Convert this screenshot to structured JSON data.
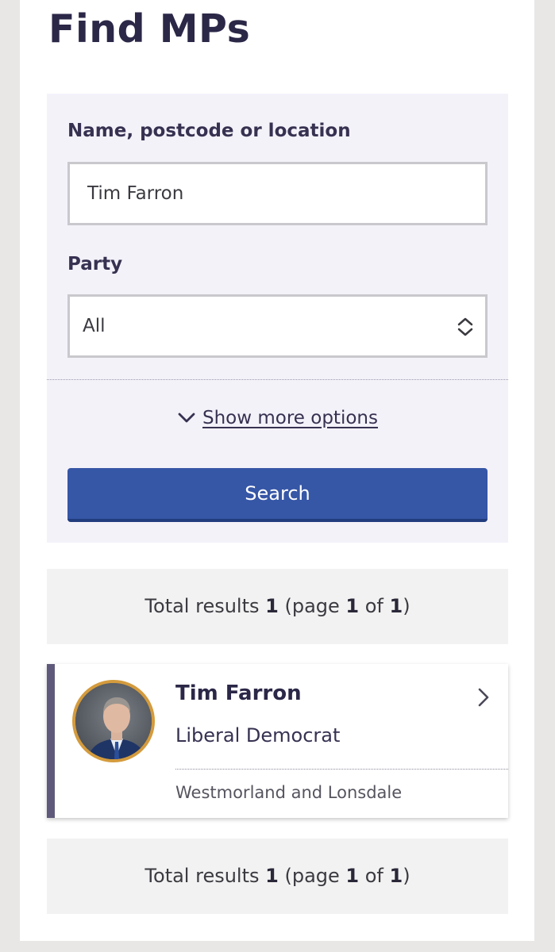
{
  "page": {
    "title": "Find MPs"
  },
  "search": {
    "name_label": "Name, postcode or location",
    "name_value": "Tim Farron",
    "party_label": "Party",
    "party_value": "All",
    "more_options_label": "Show more options",
    "search_button_label": "Search"
  },
  "results_summary": {
    "prefix": "Total results ",
    "total": "1",
    "page_prefix": " (page ",
    "page": "1",
    "of_text": " of ",
    "pages": "1",
    "suffix": ")"
  },
  "results": [
    {
      "name": "Tim Farron",
      "party": "Liberal Democrat",
      "constituency": "Westmorland and Lonsdale"
    }
  ],
  "colors": {
    "party_accent": "#5f5a7b",
    "avatar_ring": "#d49b3d",
    "button": "#3656a6",
    "heading": "#2b2747"
  },
  "icons": {
    "select": "chevron-up-down-icon",
    "more_options": "chevron-down-icon",
    "card": "chevron-right-icon"
  }
}
